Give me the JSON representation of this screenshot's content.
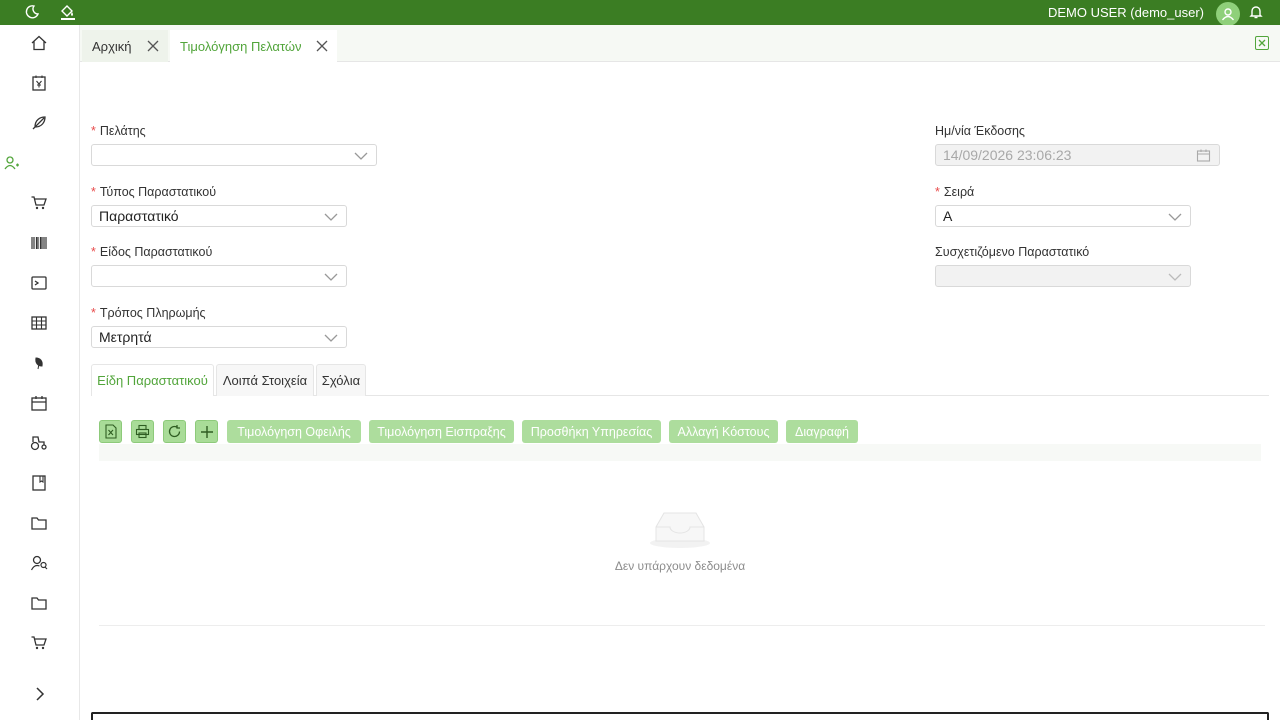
{
  "header": {
    "user": "DEMO USER (demo_user)",
    "icons": [
      "moon-icon",
      "paint-bucket-icon",
      "avatar-icon",
      "bell-icon"
    ]
  },
  "sidebar": {
    "items": [
      "home-icon",
      "invoice-yen-icon",
      "feather-icon",
      "user-plus-icon",
      "cart-icon",
      "barcode-icon",
      "terminal-icon",
      "table-icon",
      "leaf-icon",
      "calendar-icon",
      "tractor-icon",
      "book-icon",
      "folder-icon",
      "user-search-icon",
      "folder-icon",
      "cart-icon"
    ],
    "expand": "chevron-right-icon"
  },
  "tabs": [
    {
      "label": "Αρχική"
    },
    {
      "label": "Τιμολόγηση Πελατών"
    }
  ],
  "form": {
    "customer": {
      "label": "Πελάτης",
      "value": ""
    },
    "doc_type": {
      "label": "Τύπος Παραστατικού",
      "value": "Παραστατικό"
    },
    "doc_kind": {
      "label": "Είδος Παραστατικού",
      "value": ""
    },
    "payment": {
      "label": "Τρόπος Πληρωμής",
      "value": "Μετρητά"
    },
    "issue_date": {
      "label": "Ημ/νία Έκδοσης",
      "value": "14/09/2026 23:06:23"
    },
    "series": {
      "label": "Σειρά",
      "value": "A"
    },
    "related": {
      "label": "Συσχετιζόμενο Παραστατικό",
      "value": ""
    },
    "required_mark": "*"
  },
  "inner_tabs": [
    {
      "label": "Είδη Παραστατικού"
    },
    {
      "label": "Λοιπά Στοιχεία"
    },
    {
      "label": "Σχόλια"
    }
  ],
  "toolbar": {
    "icons": [
      "excel-export-icon",
      "print-icon",
      "refresh-icon",
      "plus-icon"
    ],
    "buttons": [
      "Τιμολόγηση Οφειλής",
      "Τιμολόγηση Εισπραξης",
      "Προσθήκη Υπηρεσίας",
      "Αλλαγή Κόστους",
      "Διαγραφή"
    ]
  },
  "grid": {
    "empty_text": "Δεν υπάρχουν δεδομένα"
  },
  "colors": {
    "brand": "#3b7d23",
    "accent": "#52a53b",
    "button_disabled": "#a9dc98",
    "required": "#e84b4b"
  }
}
